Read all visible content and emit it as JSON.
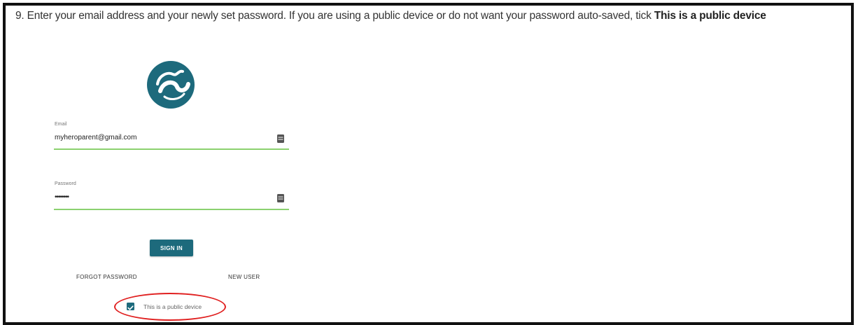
{
  "instruction": {
    "text": "9. Enter your email address and your newly set password. If you are using a public device or do not want your password auto-saved, tick ",
    "bold_text": "This is a public device"
  },
  "login": {
    "logo_icon": "swirl-logo-icon",
    "brand_color": "#1d6a7c",
    "email": {
      "label": "Email",
      "value": "myheroparent@gmail.com"
    },
    "password": {
      "label": "Password",
      "value": "••••••••"
    },
    "signin_label": "SIGN IN",
    "forgot_password_label": "FORGOT PASSWORD",
    "new_user_label": "NEW USER",
    "public_device": {
      "label": "This is a public device",
      "checked": true
    },
    "field_underline_color": "#8bd16f",
    "highlight_color": "#e02020"
  }
}
